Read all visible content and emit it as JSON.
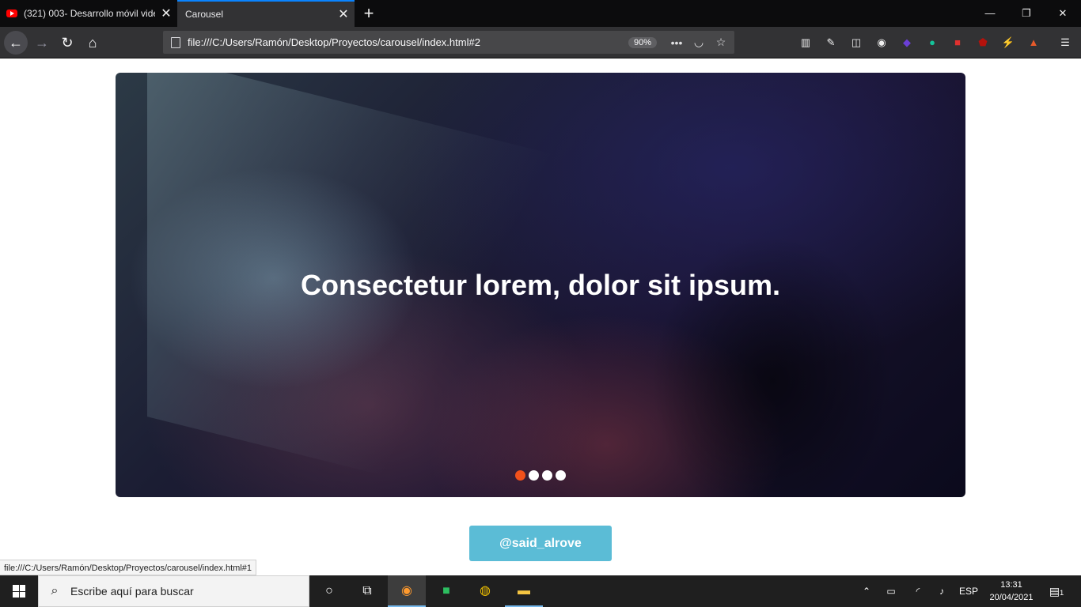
{
  "browser": {
    "tabs": [
      {
        "title": "(321) 003- Desarrollo móvil vide",
        "icon": "youtube-icon",
        "active": false
      },
      {
        "title": "Carousel",
        "active": true
      }
    ],
    "new_tab": "+",
    "window_controls": {
      "minimize": "—",
      "restore": "❐",
      "close": "✕"
    },
    "url": "file:///C:/Users/Ramón/Desktop/Proyectos/carousel/index.html#2",
    "zoom": "90%",
    "nav": {
      "back": "←",
      "forward": "→",
      "reload": "↻",
      "home": "⌂"
    }
  },
  "page": {
    "carousel": {
      "title": "Consectetur lorem, dolor sit ipsum.",
      "dots": [
        {
          "active": true
        },
        {
          "active": false
        },
        {
          "active": false
        },
        {
          "active": false
        }
      ]
    },
    "handle_button": "@said_alrove",
    "status_link": "file:///C:/Users/Ramón/Desktop/Proyectos/carousel/index.html#1"
  },
  "taskbar": {
    "search_placeholder": "Escribe aquí para buscar",
    "language": "ESP",
    "time": "13:31",
    "date": "20/04/2021",
    "notifications": "1"
  },
  "colors": {
    "accent": "#0a84ff",
    "dot_active": "#f2511b",
    "button": "#5bbcd6"
  }
}
